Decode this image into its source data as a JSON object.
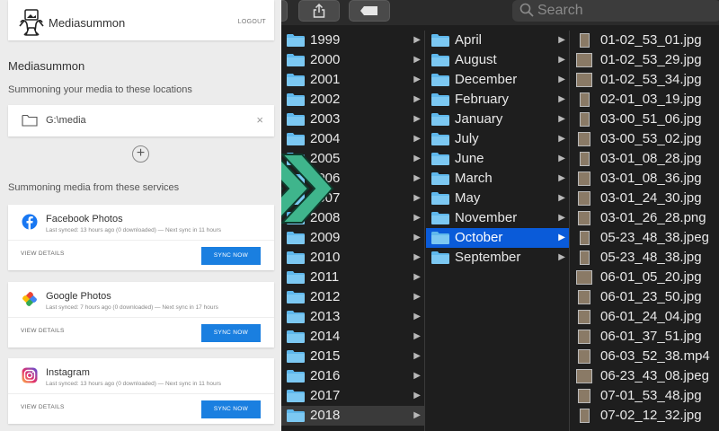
{
  "finder": {
    "search_placeholder": "Search",
    "years": [
      {
        "name": "1999"
      },
      {
        "name": "2000"
      },
      {
        "name": "2001"
      },
      {
        "name": "2002"
      },
      {
        "name": "2003"
      },
      {
        "name": "2004"
      },
      {
        "name": "2005"
      },
      {
        "name": "2006"
      },
      {
        "name": "2007"
      },
      {
        "name": "2008"
      },
      {
        "name": "2009"
      },
      {
        "name": "2010"
      },
      {
        "name": "2011"
      },
      {
        "name": "2012"
      },
      {
        "name": "2013"
      },
      {
        "name": "2014"
      },
      {
        "name": "2015"
      },
      {
        "name": "2016"
      },
      {
        "name": "2017"
      },
      {
        "name": "2018",
        "state": "dim"
      }
    ],
    "months": [
      {
        "name": "April"
      },
      {
        "name": "August"
      },
      {
        "name": "December"
      },
      {
        "name": "February"
      },
      {
        "name": "January"
      },
      {
        "name": "July"
      },
      {
        "name": "June"
      },
      {
        "name": "March"
      },
      {
        "name": "May"
      },
      {
        "name": "November"
      },
      {
        "name": "October",
        "state": "sel"
      },
      {
        "name": "September"
      }
    ],
    "files": [
      {
        "name": "01-02_53_01.jpg",
        "orient": "portrait"
      },
      {
        "name": "01-02_53_29.jpg",
        "orient": "wide"
      },
      {
        "name": "01-02_53_34.jpg",
        "orient": "wide"
      },
      {
        "name": "02-01_03_19.jpg",
        "orient": "portrait"
      },
      {
        "name": "03-00_51_06.jpg",
        "orient": "portrait"
      },
      {
        "name": "03-00_53_02.jpg",
        "orient": "square"
      },
      {
        "name": "03-01_08_28.jpg",
        "orient": "portrait"
      },
      {
        "name": "03-01_08_36.jpg",
        "orient": "square"
      },
      {
        "name": "03-01_24_30.jpg",
        "orient": "square"
      },
      {
        "name": "03-01_26_28.png",
        "orient": "square"
      },
      {
        "name": "05-23_48_38.jpeg",
        "orient": "portrait"
      },
      {
        "name": "05-23_48_38.jpg",
        "orient": "portrait"
      },
      {
        "name": "06-01_05_20.jpg",
        "orient": "wide"
      },
      {
        "name": "06-01_23_50.jpg",
        "orient": "square"
      },
      {
        "name": "06-01_24_04.jpg",
        "orient": "square"
      },
      {
        "name": "06-01_37_51.jpg",
        "orient": "square"
      },
      {
        "name": "06-03_52_38.mp4",
        "orient": "square"
      },
      {
        "name": "06-23_43_08.jpeg",
        "orient": "wide"
      },
      {
        "name": "07-01_53_48.jpg",
        "orient": "square"
      },
      {
        "name": "07-02_12_32.jpg",
        "orient": "portrait"
      }
    ],
    "colors": {
      "selection": "#0a5bd9",
      "folder": "#5fb8ec",
      "background": "#1e1e1e"
    }
  },
  "app": {
    "name": "Mediasummon",
    "logout_label": "LOGOUT",
    "section_title": "Mediasummon",
    "locations_label": "Summoning your media to these locations",
    "location": {
      "path": "G:\\media",
      "remove_symbol": "×"
    },
    "add_symbol": "+",
    "services_label": "Summoning media from these services",
    "services": [
      {
        "name": "Facebook Photos",
        "icon": "facebook-icon",
        "status": "Last synced: 13 hours ago (0 downloaded) — Next sync in 11 hours",
        "details_label": "VIEW DETAILS",
        "sync_label": "SYNC NOW"
      },
      {
        "name": "Google Photos",
        "icon": "google-photos-icon",
        "status": "Last synced: 7 hours ago (0 downloaded) — Next sync in 17 hours",
        "details_label": "VIEW DETAILS",
        "sync_label": "SYNC NOW"
      },
      {
        "name": "Instagram",
        "icon": "instagram-icon",
        "status": "Last synced: 13 hours ago (0 downloaded) — Next sync in 11 hours",
        "details_label": "VIEW DETAILS",
        "sync_label": "SYNC NOW"
      }
    ],
    "colors": {
      "sync_button": "#1a7fe0",
      "arrows": "#3fb58c"
    }
  }
}
